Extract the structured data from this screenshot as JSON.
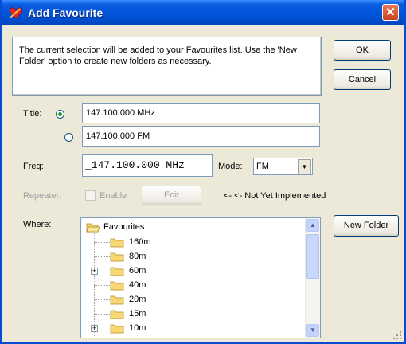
{
  "window": {
    "title": "Add Favourite",
    "close_glyph": "✕",
    "title_icon": "heart-arrow-icon"
  },
  "info": {
    "text": "The current selection will be added to your Favourites list. Use the 'New Folder' option to create new folders as necessary."
  },
  "buttons": {
    "ok": "OK",
    "cancel": "Cancel",
    "edit": "Edit",
    "new_folder": "New Folder"
  },
  "title_section": {
    "label": "Title:",
    "option1_value": "147.100.000 MHz",
    "option2_value": "147.100.000 FM",
    "selected": 1
  },
  "freq": {
    "label": "Freq:",
    "value": "_147.100.000 MHz"
  },
  "mode": {
    "label": "Mode:",
    "value": "FM"
  },
  "repeater": {
    "label": "Repeater:",
    "enable_label": "Enable",
    "note": "<- <- Not Yet Implemented",
    "enabled": false
  },
  "where": {
    "label": "Where:",
    "root": "Favourites",
    "items": [
      "160m",
      "80m",
      "60m",
      "40m",
      "20m",
      "15m",
      "10m"
    ]
  },
  "colors": {
    "title_bar": "#0054e3",
    "close_button": "#d8532f",
    "dialog_bg": "#ece9d8",
    "folder": "#f8d775"
  }
}
